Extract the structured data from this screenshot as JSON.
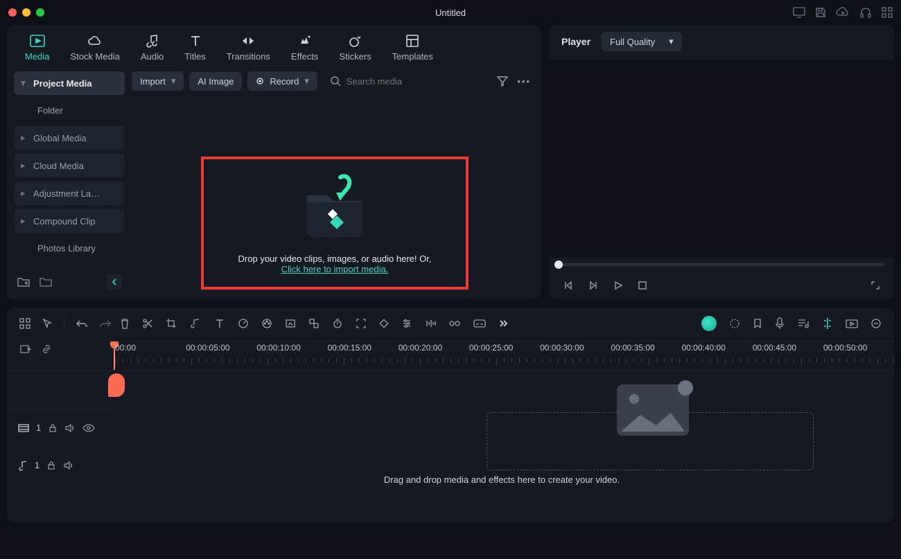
{
  "window": {
    "title": "Untitled"
  },
  "tabs": [
    {
      "label": "Media"
    },
    {
      "label": "Stock Media"
    },
    {
      "label": "Audio"
    },
    {
      "label": "Titles"
    },
    {
      "label": "Transitions"
    },
    {
      "label": "Effects"
    },
    {
      "label": "Stickers"
    },
    {
      "label": "Templates"
    }
  ],
  "sidebar": {
    "items": [
      {
        "label": "Project Media",
        "active": true,
        "caret": "▾"
      },
      {
        "label": "Folder",
        "plain": true
      },
      {
        "label": "Global Media",
        "caret": "▸"
      },
      {
        "label": "Cloud Media",
        "caret": "▸"
      },
      {
        "label": "Adjustment La…",
        "caret": "▸"
      },
      {
        "label": "Compound Clip",
        "caret": "▸"
      },
      {
        "label": "Photos Library",
        "plain": true
      }
    ]
  },
  "mediaToolbar": {
    "import": "Import",
    "aiImage": "AI Image",
    "record": "Record",
    "searchPlaceholder": "Search media"
  },
  "dropZone": {
    "line1": "Drop your video clips, images, or audio here! Or,",
    "link": "Click here to import media."
  },
  "player": {
    "label": "Player",
    "quality": "Full Quality"
  },
  "ruler": {
    "labels": [
      "00:00",
      "00:00:05:00",
      "00:00:10:00",
      "00:00:15:00",
      "00:00:20:00",
      "00:00:25:00",
      "00:00:30:00",
      "00:00:35:00",
      "00:00:40:00",
      "00:00:45:00",
      "00:00:50:00"
    ]
  },
  "tracks": {
    "video": "1",
    "audio": "1"
  },
  "timelineHint": "Drag and drop media and effects here to create your video."
}
